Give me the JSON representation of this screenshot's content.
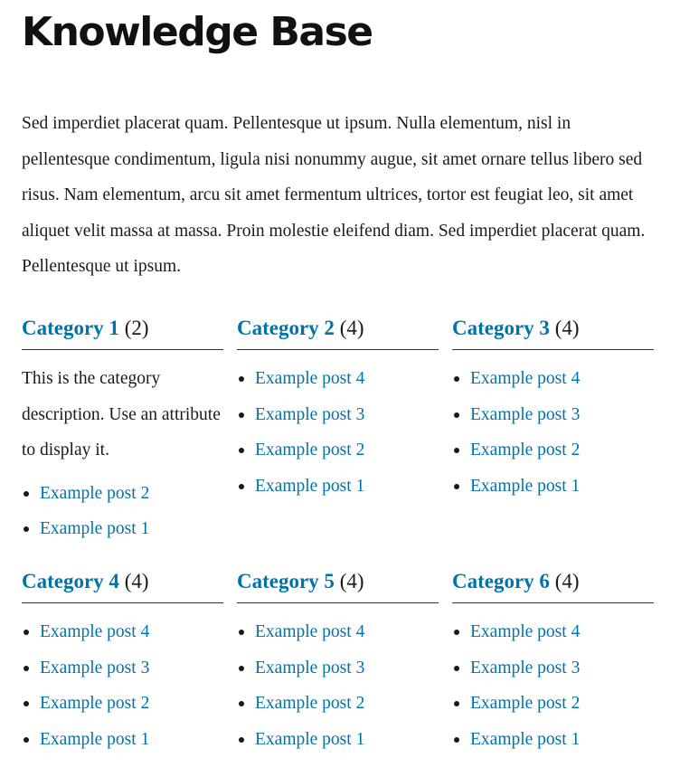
{
  "page": {
    "title": "Knowledge Base",
    "intro": "Sed imperdiet placerat quam. Pellentesque ut ipsum. Nulla elementum, nisl in pellentesque condimentum, ligula nisi nonummy augue, sit amet ornare tellus libero sed risus. Nam elementum, arcu sit amet fermentum ultrices, tortor est feugiat leo, sit amet aliquet velit massa at massa. Proin molestie eleifend diam. Sed imperdiet placerat quam. Pellentesque ut ipsum."
  },
  "colors": {
    "link": "#0073aa",
    "text": "#1a1a1a",
    "rule": "#333333"
  },
  "categories": [
    {
      "title": "Category 1",
      "count": "(2)",
      "description": "This is the category description. Use an attribute to display it.",
      "posts": [
        "Example post 2",
        "Example post 1"
      ]
    },
    {
      "title": "Category 2",
      "count": "(4)",
      "posts": [
        "Example post 4",
        "Example post 3",
        "Example post 2",
        "Example post 1"
      ]
    },
    {
      "title": "Category 3",
      "count": "(4)",
      "posts": [
        "Example post 4",
        "Example post 3",
        "Example post 2",
        "Example post 1"
      ]
    },
    {
      "title": "Category 4",
      "count": "(4)",
      "posts": [
        "Example post 4",
        "Example post 3",
        "Example post 2",
        "Example post 1"
      ]
    },
    {
      "title": "Category 5",
      "count": "(4)",
      "posts": [
        "Example post 4",
        "Example post 3",
        "Example post 2",
        "Example post 1"
      ]
    },
    {
      "title": "Category 6",
      "count": "(4)",
      "posts": [
        "Example post 4",
        "Example post 3",
        "Example post 2",
        "Example post 1"
      ]
    }
  ]
}
